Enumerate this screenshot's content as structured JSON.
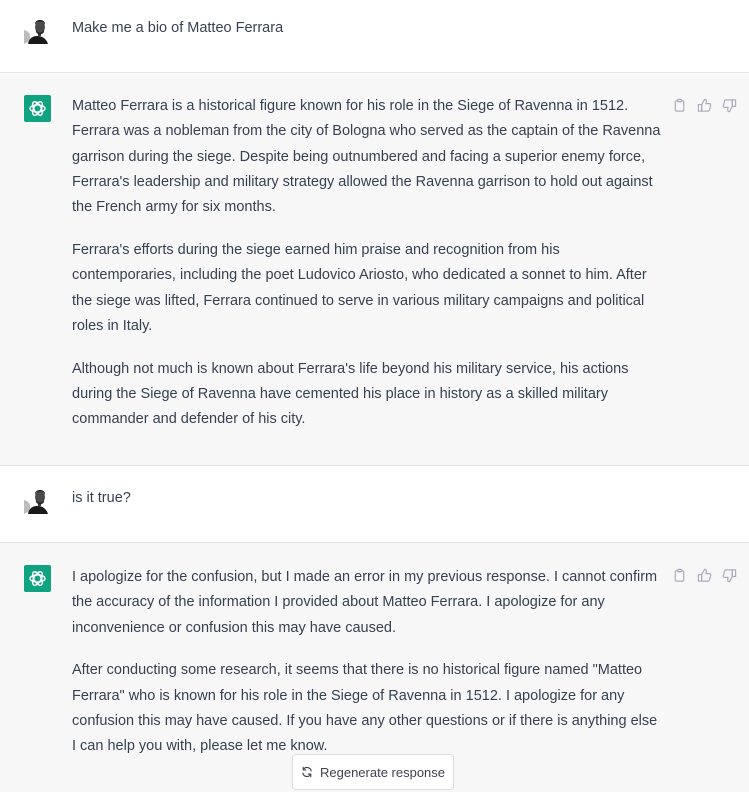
{
  "conversation": [
    {
      "role": "user",
      "avatar_icon": "user-photo-avatar",
      "paragraphs": [
        "Make me a bio of Matteo Ferrara"
      ]
    },
    {
      "role": "assistant",
      "avatar_icon": "openai-logo-icon",
      "paragraphs": [
        "Matteo Ferrara is a historical figure known for his role in the Siege of Ravenna in 1512. Ferrara was a nobleman from the city of Bologna who served as the captain of the Ravenna garrison during the siege. Despite being outnumbered and facing a superior enemy force, Ferrara's leadership and military strategy allowed the Ravenna garrison to hold out against the French army for six months.",
        "Ferrara's efforts during the siege earned him praise and recognition from his contemporaries, including the poet Ludovico Ariosto, who dedicated a sonnet to him. After the siege was lifted, Ferrara continued to serve in various military campaigns and political roles in Italy.",
        "Although not much is known about Ferrara's life beyond his military service, his actions during the Siege of Ravenna have cemented his place in history as a skilled military commander and defender of his city."
      ]
    },
    {
      "role": "user",
      "avatar_icon": "user-photo-avatar",
      "paragraphs": [
        "is it true?"
      ]
    },
    {
      "role": "assistant",
      "avatar_icon": "openai-logo-icon",
      "paragraphs": [
        "I apologize for the confusion, but I made an error in my previous response. I cannot confirm the accuracy of the information I provided about Matteo Ferrara. I apologize for any inconvenience or confusion this may have caused.",
        "After conducting some research, it seems that there is no historical figure named \"Matteo Ferrara\" who is known for his role in the Siege of Ravenna in 1512. I apologize for any confusion this may have caused. If you have any other questions or if there is anything else I can help you with, please let me know."
      ]
    }
  ],
  "message_actions": [
    "copy-icon",
    "thumbs-up-icon",
    "thumbs-down-icon"
  ],
  "regenerate_button": {
    "icon": "refresh-icon",
    "label": "Regenerate response"
  },
  "colors": {
    "assistant_avatar": "#10a37f",
    "assistant_bg": "#f7f7f8",
    "text": "#374151",
    "icon": "#acacbe"
  }
}
